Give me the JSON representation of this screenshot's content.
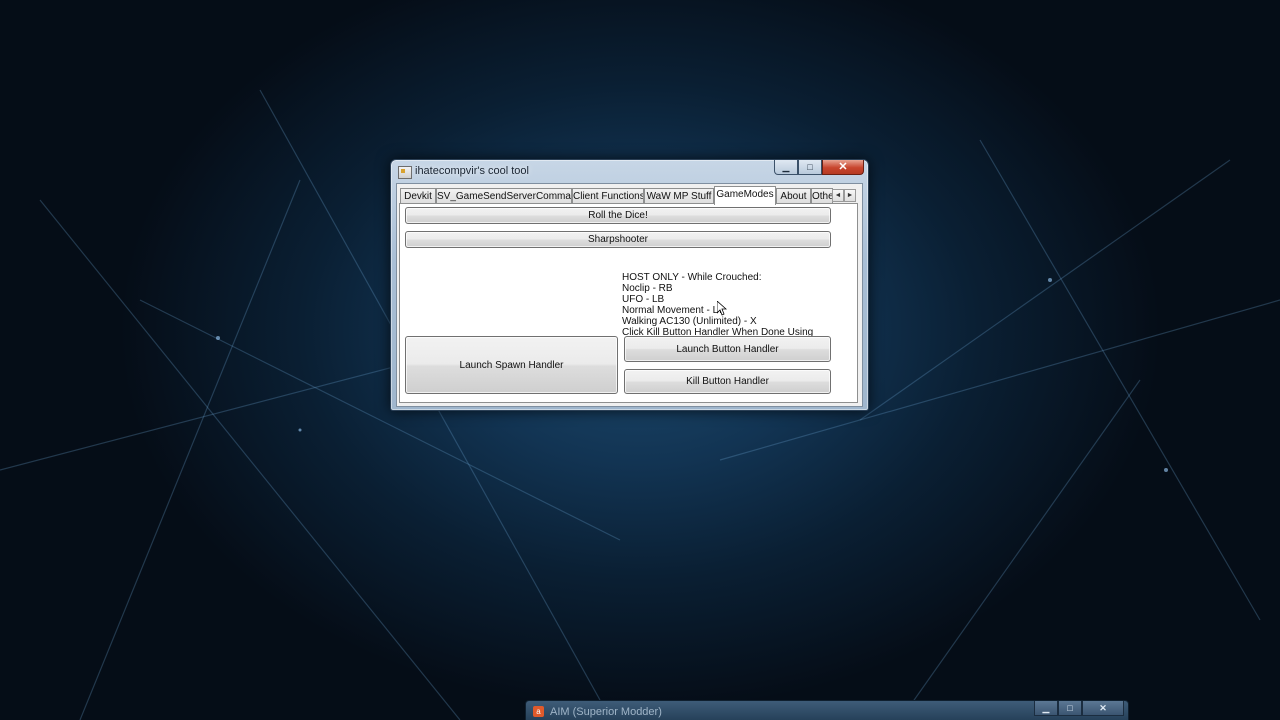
{
  "window": {
    "title": "ihatecompvir's cool tool",
    "min_glyph": "▁",
    "max_glyph": "□",
    "close_glyph": "✕"
  },
  "tabs": [
    {
      "label": "Devkit",
      "active": false
    },
    {
      "label": "SV_GameSendServerCommand",
      "active": false
    },
    {
      "label": "Client Functions",
      "active": false
    },
    {
      "label": "WaW MP Stuff",
      "active": false
    },
    {
      "label": "GameModes",
      "active": true
    },
    {
      "label": "About",
      "active": false
    },
    {
      "label": "Othe",
      "active": false
    }
  ],
  "tab_scroll": {
    "left": "◄",
    "right": "►"
  },
  "gamemodes": {
    "roll_dice_label": "Roll the Dice!",
    "sharpshooter_label": "Sharpshooter",
    "spawn_handler_label": "Launch Spawn Handler",
    "launch_button_handler_label": "Launch Button Handler",
    "kill_button_handler_label": "Kill Button Handler",
    "info_lines": [
      "HOST ONLY - While Crouched:",
      "Noclip - RB",
      "UFO - LB",
      "Normal Movement - LT",
      "Walking AC130 (Unlimited) - X",
      "Click Kill Button Handler When Done Using"
    ]
  },
  "second_window": {
    "icon": "a",
    "title": "AIM (Superior Modder)",
    "min_glyph": "▁",
    "max_glyph": "□",
    "close_glyph": "✕"
  },
  "colors": {
    "desktop": "#0a1f33",
    "window_frame": "#a9bfd6",
    "close_button": "#c8452e"
  }
}
